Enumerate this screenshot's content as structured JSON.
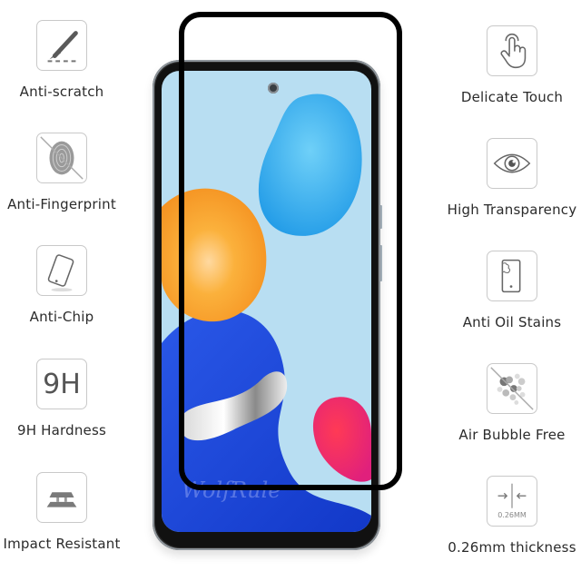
{
  "left_features": [
    {
      "icon": "scalpel-icon",
      "label": "Anti-scratch"
    },
    {
      "icon": "fingerprint-crossed-icon",
      "label": "Anti-Fingerprint"
    },
    {
      "icon": "tilted-phone-icon",
      "label": "Anti-Chip"
    },
    {
      "icon": "9h-text-icon",
      "label": "9H Hardness",
      "icon_text": "9H"
    },
    {
      "icon": "layered-plates-icon",
      "label": "Impact Resistant"
    }
  ],
  "right_features": [
    {
      "icon": "pointing-hand-icon",
      "label": "Delicate Touch"
    },
    {
      "icon": "eye-icon",
      "label": "High Transparency"
    },
    {
      "icon": "phone-oil-splash-icon",
      "label": "Anti Oil Stains"
    },
    {
      "icon": "bubbles-crossed-icon",
      "label": "Air Bubble Free"
    },
    {
      "icon": "thickness-arrows-icon",
      "label": "0.26mm thickness",
      "icon_text": "0.26MM"
    }
  ],
  "phone": {
    "watermark": "WolfRule",
    "colors": {
      "screen_bg": "#b8def2",
      "blob_blue": "#2fa8ea",
      "blob_orange": "#f79a23",
      "blob_deep_blue": "#1f4fe0",
      "blob_pink": "#f23a6a",
      "frame": "#000000"
    }
  }
}
